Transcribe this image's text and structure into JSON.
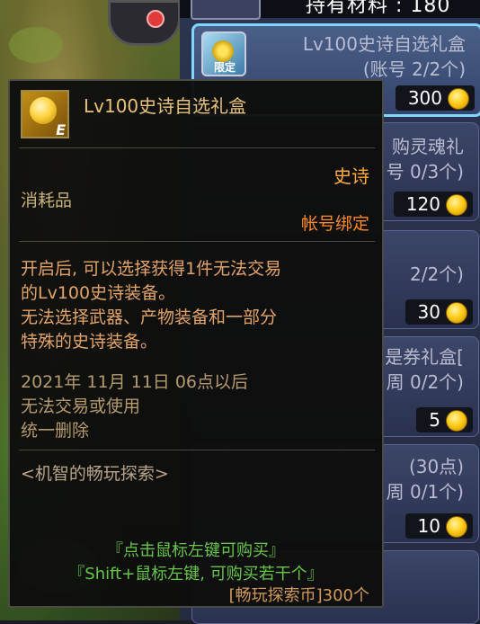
{
  "header": {
    "holding_label": "持有材料 : 180"
  },
  "shop_items": [
    {
      "name_line1": "Lv100史诗自选礼盒",
      "name_line2": "(账号 2/2个)",
      "price": "300",
      "icon_tag": "限定",
      "selected": true
    },
    {
      "name_line1": "购灵魂礼",
      "name_line2": "号 0/3个)",
      "price": "120"
    },
    {
      "name_line1": "",
      "name_line2": "2/2个)",
      "price": "30"
    },
    {
      "name_line1": "是券礼盒[",
      "name_line2": "周 0/2个)",
      "price": "5"
    },
    {
      "name_line1": "(30点)",
      "name_line2": "周 0/1个)",
      "price": "10"
    }
  ],
  "tooltip": {
    "icon_grade": "E",
    "title": "Lv100史诗自选礼盒",
    "rarity": "史诗",
    "item_type": "消耗品",
    "bind_type": "帐号绑定",
    "description": [
      "开启后, 可以选择获得1件无法交易",
      "的Lv100史诗装备。",
      "无法选择武器、产物装备和一部分",
      "特殊的史诗装备。"
    ],
    "expire_lines": [
      "2021年 11月 11日 06点以后",
      "无法交易或使用",
      "统一删除"
    ],
    "source": "<机智的畅玩探索>",
    "hint_click": "『点击鼠标左键可购买』",
    "hint_shift": "『Shift+鼠标左键, 可购买若干个』",
    "currency": "[畅玩探索币]300个"
  },
  "colors": {
    "tooltip_bg": "#0e0e0d",
    "rarity": "#ffab3c",
    "bind": "#ff8a2a",
    "hint": "#67c64a",
    "selected_border": "#7fd6ff"
  }
}
